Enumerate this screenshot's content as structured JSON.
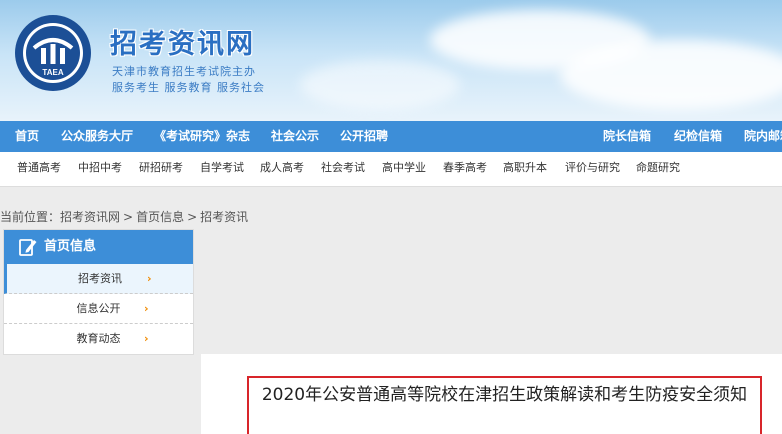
{
  "header": {
    "site_title": "招考资讯网",
    "org_name": "天津市教育招生考试院主办",
    "org_slogan": "服务考生 服务教育 服务社会",
    "logo_text": "TAEA"
  },
  "main_nav": {
    "items": [
      {
        "label": "首页"
      },
      {
        "label": "公众服务大厅"
      },
      {
        "label": "《考试研究》杂志"
      },
      {
        "label": "社会公示"
      },
      {
        "label": "公开招聘"
      },
      {
        "label": "院长信箱"
      },
      {
        "label": "纪检信箱"
      },
      {
        "label": "院内邮箱"
      }
    ]
  },
  "sub_nav": {
    "items": [
      {
        "label": "普通高考"
      },
      {
        "label": "中招中考"
      },
      {
        "label": "研招研考"
      },
      {
        "label": "自学考试"
      },
      {
        "label": "成人高考"
      },
      {
        "label": "社会考试"
      },
      {
        "label": "高中学业"
      },
      {
        "label": "春季高考"
      },
      {
        "label": "高职升本"
      },
      {
        "label": "评价与研究"
      },
      {
        "label": "命题研究"
      }
    ]
  },
  "breadcrumb": {
    "prefix": "当前位置：",
    "items": [
      "招考资讯网",
      "首页信息",
      "招考资讯"
    ],
    "separator": ">"
  },
  "sidebar": {
    "title": "首页信息",
    "items": [
      {
        "label": "招考资讯",
        "arrow": "›"
      },
      {
        "label": "信息公开",
        "arrow": "›"
      },
      {
        "label": "教育动态",
        "arrow": "›"
      }
    ]
  },
  "article": {
    "title": "2020年公安普通高等院校在津招生政策解读和考生防疫安全须知"
  },
  "colors": {
    "nav_blue": "#3d8ed8",
    "arrow_orange": "#f08a00",
    "title_border_red": "#d8252a"
  }
}
